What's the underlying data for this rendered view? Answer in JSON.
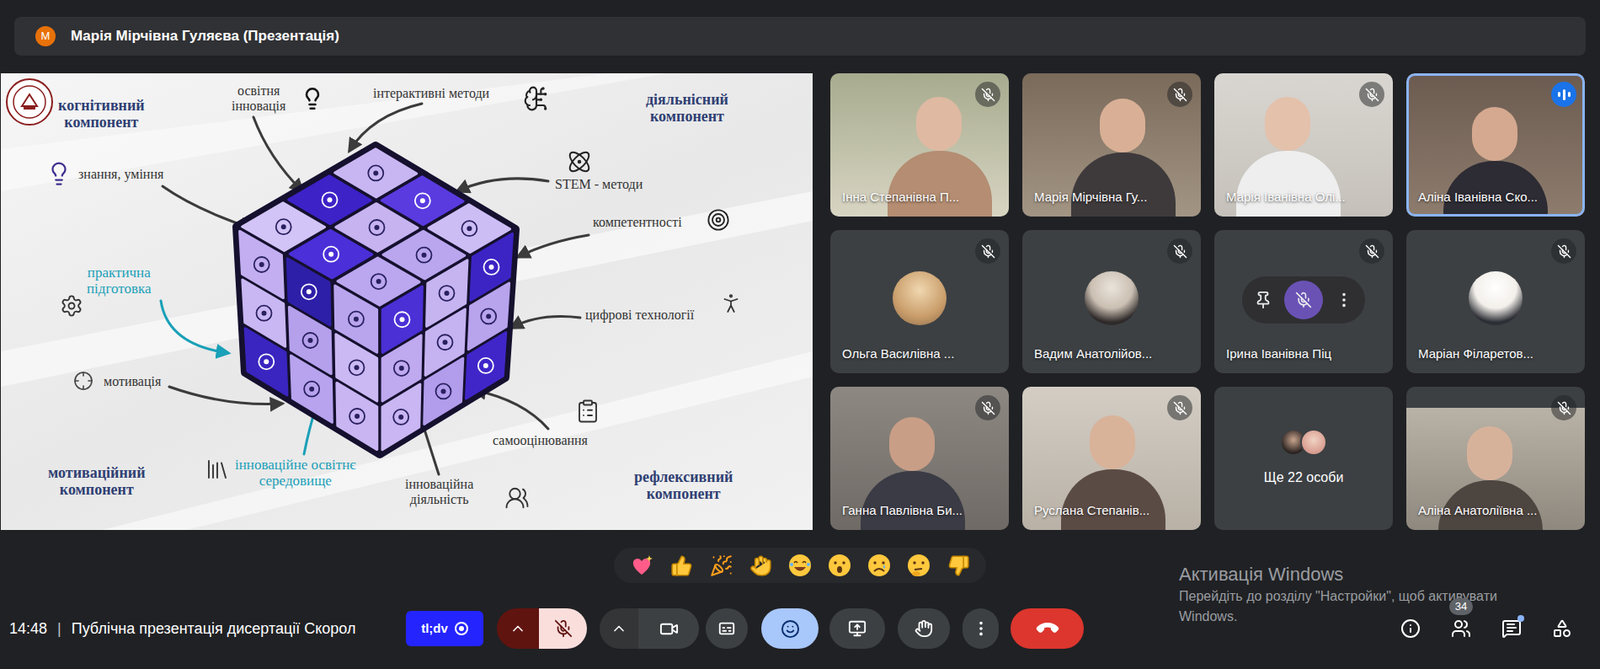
{
  "presenter_bar": {
    "avatar": "М",
    "title": "Марія Мірчівна Гуляєва (Презентація)"
  },
  "slide": {
    "labels": [
      {
        "lines": [
          "когнітивний",
          "компонент"
        ],
        "kind": "component"
      },
      {
        "lines": [
          "освітня",
          "інновація"
        ],
        "kind": "item"
      },
      {
        "lines": [
          "інтерактивні методи"
        ],
        "kind": "item"
      },
      {
        "lines": [
          "діяльнісний",
          "компонент"
        ],
        "kind": "component"
      },
      {
        "lines": [
          "знання, уміння"
        ],
        "kind": "item"
      },
      {
        "lines": [
          "STEM - методи"
        ],
        "kind": "item"
      },
      {
        "lines": [
          "компетентності"
        ],
        "kind": "item"
      },
      {
        "lines": [
          "практична",
          "підготовка"
        ],
        "kind": "accent"
      },
      {
        "lines": [
          "цифрові технології"
        ],
        "kind": "item"
      },
      {
        "lines": [
          "мотивація"
        ],
        "kind": "item"
      },
      {
        "lines": [
          "самооцінювання"
        ],
        "kind": "item"
      },
      {
        "lines": [
          "мотиваційний",
          "компонент"
        ],
        "kind": "component"
      },
      {
        "lines": [
          "інноваційне освітнє",
          "середовище"
        ],
        "kind": "accent"
      },
      {
        "lines": [
          "інноваційна",
          "діяльність"
        ],
        "kind": "item"
      },
      {
        "lines": [
          "рефлексивний",
          "компонент"
        ],
        "kind": "component"
      }
    ]
  },
  "participants": [
    {
      "name": "Інна Степанівна П...",
      "kind": "video",
      "muted": true,
      "speaking": false,
      "hovered": false
    },
    {
      "name": "Марія Мірчівна Гу...",
      "kind": "video",
      "muted": true,
      "speaking": false,
      "hovered": false
    },
    {
      "name": "Марія Іванівна Олі...",
      "kind": "video",
      "muted": true,
      "speaking": false,
      "hovered": false
    },
    {
      "name": "Аліна Іванівна Ско...",
      "kind": "video",
      "muted": false,
      "speaking": true,
      "hovered": false
    },
    {
      "name": "Ольга Василівна ...",
      "kind": "avatar",
      "muted": true,
      "speaking": false,
      "hovered": false
    },
    {
      "name": "Вадим Анатолійов...",
      "kind": "avatar",
      "muted": true,
      "speaking": false,
      "hovered": false
    },
    {
      "name": "Ірина Іванівна Піц",
      "kind": "blank",
      "muted": true,
      "speaking": false,
      "hovered": true
    },
    {
      "name": "Маріан Філаретов...",
      "kind": "avatar",
      "muted": true,
      "speaking": false,
      "hovered": false
    },
    {
      "name": "Ганна Павлівна Би...",
      "kind": "video",
      "muted": true,
      "speaking": false,
      "hovered": false
    },
    {
      "name": "Руслана Степанів...",
      "kind": "video",
      "muted": true,
      "speaking": false,
      "hovered": false
    },
    {
      "name": "Ще 22 особи",
      "kind": "others",
      "muted": false,
      "speaking": false,
      "hovered": false
    },
    {
      "name": "Аліна Анатоліївна ...",
      "kind": "video",
      "muted": true,
      "speaking": false,
      "hovered": false
    }
  ],
  "reactions": [
    {
      "kind": "heart"
    },
    {
      "kind": "thumbs-up"
    },
    {
      "kind": "party"
    },
    {
      "kind": "clap"
    },
    {
      "kind": "laugh"
    },
    {
      "kind": "surprised"
    },
    {
      "kind": "sad"
    },
    {
      "kind": "thinking"
    },
    {
      "kind": "thumbs-down"
    }
  ],
  "watermark": {
    "title": "Активація Windows",
    "lines": [
      "Перейдіть до розділу \"Настройки\", щоб активувати",
      "Windows."
    ]
  },
  "bottom_bar": {
    "time": "14:48",
    "separator": "|",
    "meeting_title": "Публічна презентація дисертації Скорол",
    "recorder_badge": "tl;dv",
    "mic_muted": true,
    "reactions_open": true,
    "people_count": "34",
    "chat_unread": true
  }
}
